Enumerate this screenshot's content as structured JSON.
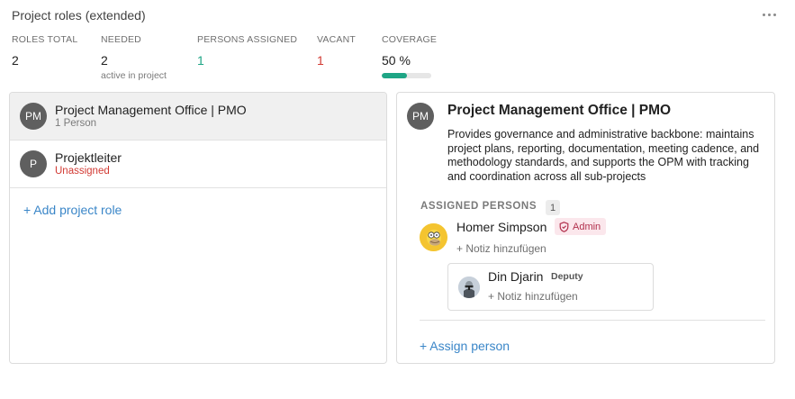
{
  "header": {
    "title": "Project roles (extended)",
    "menu_icon": "more-horizontal-icon"
  },
  "stats": {
    "roles_total": {
      "label": "ROLES TOTAL",
      "value": "2"
    },
    "needed": {
      "label": "NEEDED",
      "value": "2",
      "sub": "active in project"
    },
    "persons_assigned": {
      "label": "PERSONS ASSIGNED",
      "value": "1",
      "color": "#1ea585"
    },
    "vacant": {
      "label": "VACANT",
      "value": "1",
      "color": "#d23a33"
    },
    "coverage": {
      "label": "COVERAGE",
      "value": "50 %",
      "fraction": 0.5,
      "color": "#1ea585"
    }
  },
  "roles": [
    {
      "initials": "PM",
      "name": "Project Management Office | PMO",
      "sub": "1 Person",
      "selected": true
    },
    {
      "initials": "P",
      "name": "Projektleiter",
      "sub": "Unassigned",
      "selected": false
    }
  ],
  "add_role_label": "+ Add project role",
  "detail": {
    "initials": "PM",
    "title": "Project Management Office | PMO",
    "description": "Provides governance and administrative backbone: maintains project plans, reporting, documentation, meeting cadence, and methodology standards, and supports the OPM with tracking and coordination across all sub-projects",
    "assigned_label": "ASSIGNED PERSONS",
    "assigned_count": "1",
    "person": {
      "name": "Homer Simpson",
      "badge": "Admin",
      "badge_icon": "shield-icon",
      "note": "+ Notiz hinzufügen"
    },
    "deputy": {
      "name": "Din Djarin",
      "tag": "Deputy",
      "note": "+ Notiz hinzufügen"
    },
    "assign_label": "+ Assign person"
  }
}
